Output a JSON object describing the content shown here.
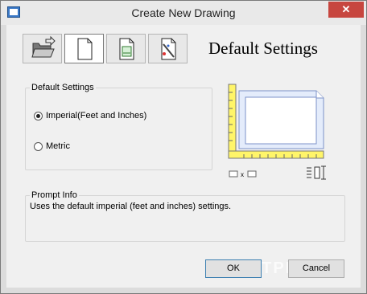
{
  "window": {
    "title": "Create New Drawing",
    "close_glyph": "✕"
  },
  "toolbar": {
    "buttons": [
      {
        "name": "open-drawing",
        "icon": "folder-open-icon"
      },
      {
        "name": "default-settings",
        "icon": "blank-page-icon",
        "active": true
      },
      {
        "name": "use-template",
        "icon": "template-page-icon"
      },
      {
        "name": "use-wizard",
        "icon": "wizard-page-icon"
      }
    ]
  },
  "main": {
    "heading": "Default Settings"
  },
  "settings_group": {
    "legend": "Default Settings",
    "options": [
      {
        "label": "Imperial(Feet and Inches)",
        "selected": true
      },
      {
        "label": "Metric",
        "selected": false
      }
    ]
  },
  "prompt_group": {
    "legend": "Prompt Info",
    "text": "Uses the default imperial (feet and inches) settings."
  },
  "buttons": {
    "ok": "OK",
    "cancel": "Cancel"
  },
  "watermark": "SOFTPEDIA",
  "colors": {
    "ruler": "#fff569",
    "preview_sheet": "#d8e4f8",
    "preview_border": "#7d92c8",
    "close": "#c7463f"
  }
}
